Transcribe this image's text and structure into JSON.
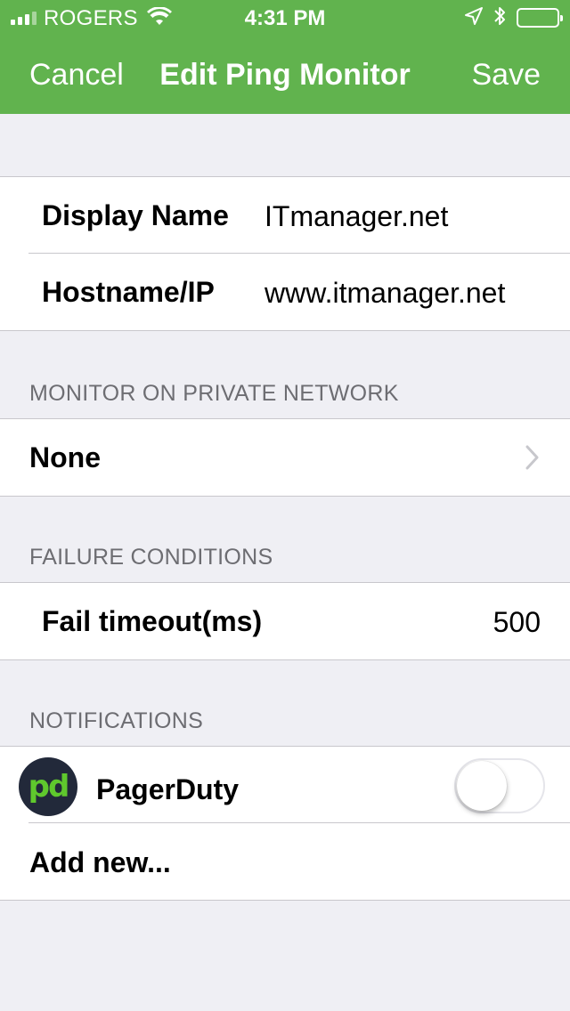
{
  "status_bar": {
    "carrier": "ROGERS",
    "time": "4:31 PM",
    "icons": [
      "signal-icon",
      "wifi-icon",
      "location-icon",
      "bluetooth-icon",
      "battery-icon"
    ]
  },
  "nav": {
    "cancel_label": "Cancel",
    "title": "Edit Ping Monitor",
    "save_label": "Save"
  },
  "general": {
    "display_name_label": "Display Name",
    "display_name_value": "ITmanager.net",
    "hostname_label": "Hostname/IP",
    "hostname_value": "www.itmanager.net"
  },
  "private_network": {
    "header": "MONITOR ON PRIVATE NETWORK",
    "selected": "None"
  },
  "failure": {
    "header": "FAILURE CONDITIONS",
    "timeout_label": "Fail timeout(ms)",
    "timeout_value": "500"
  },
  "notifications": {
    "header": "NOTIFICATIONS",
    "pagerduty_logo_text": "pd",
    "pagerduty_label": "PagerDuty",
    "pagerduty_enabled": false,
    "add_new_label": "Add new..."
  },
  "colors": {
    "brand_green": "#61b34e",
    "background": "#efeff4",
    "pagerduty_green": "#5fc82d",
    "pagerduty_dark": "#22293a"
  }
}
